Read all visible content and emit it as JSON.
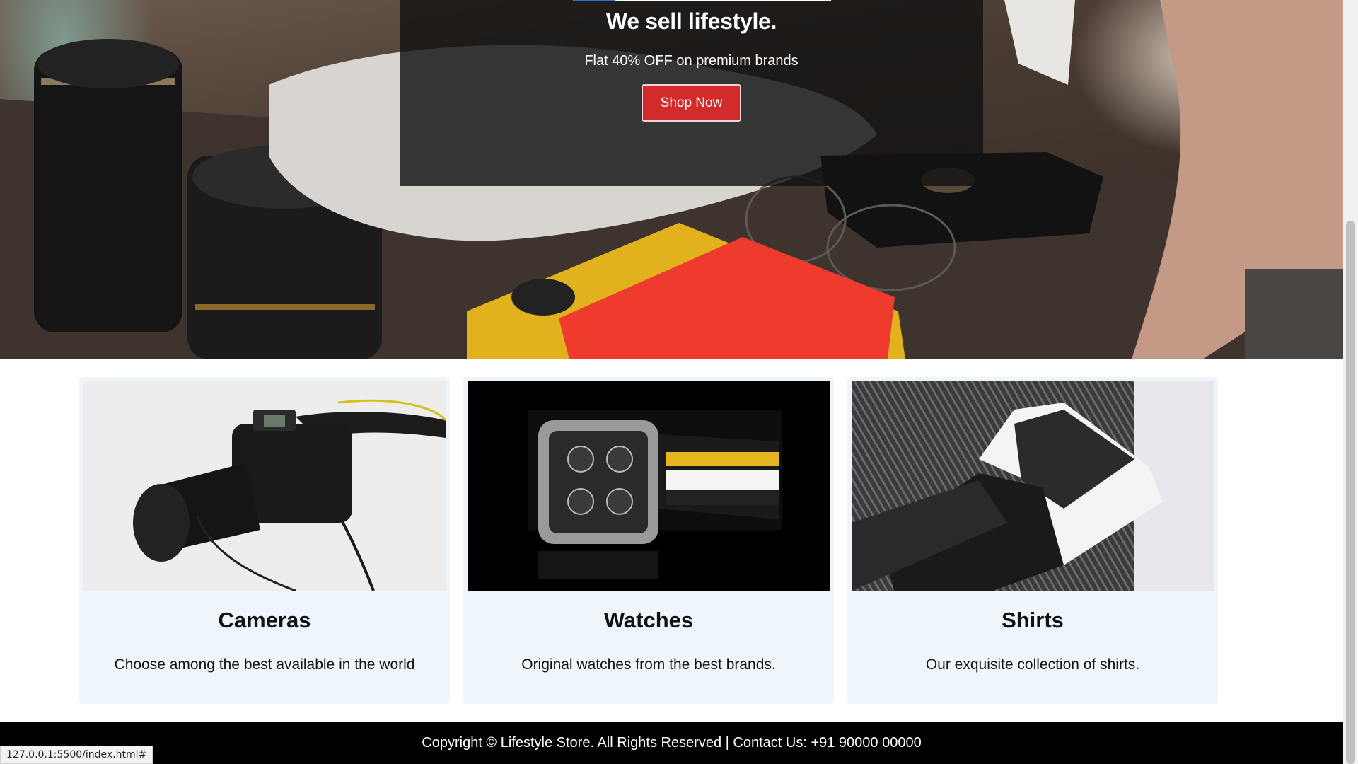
{
  "hero": {
    "title": "We sell lifestyle.",
    "subtitle": "Flat 40% OFF on premium brands",
    "button_label": "Shop Now"
  },
  "cards": [
    {
      "title": "Cameras",
      "description": "Choose among the best available in the world"
    },
    {
      "title": "Watches",
      "description": "Original watches from the best brands."
    },
    {
      "title": "Shirts",
      "description": "Our exquisite collection of shirts."
    }
  ],
  "footer": {
    "text": "Copyright © Lifestyle Store. All Rights Reserved | Contact Us: +91 90000 00000"
  },
  "status_url": "127.0.0.1:5500/index.html#",
  "colors": {
    "button": "#d32b2b",
    "card_bg": "#eef6fc",
    "footer_bg": "#000000",
    "panel": "rgba(18,18,18,0.82)"
  }
}
